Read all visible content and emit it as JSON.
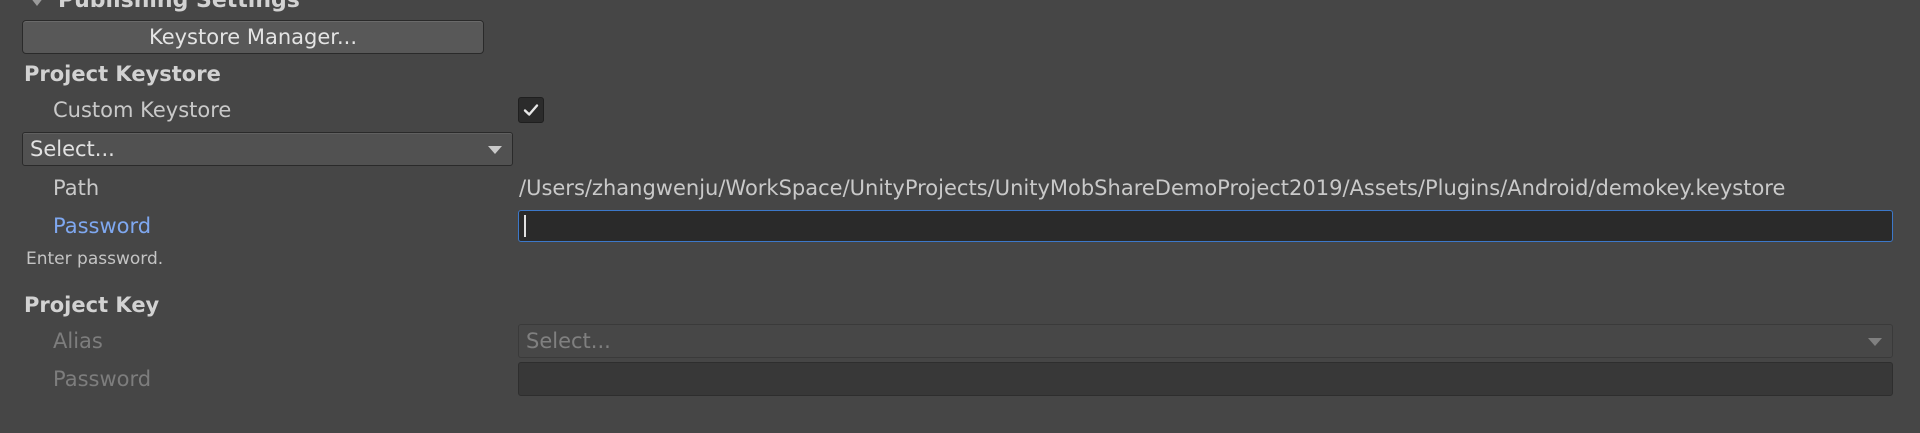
{
  "section": {
    "title": "Publishing Settings"
  },
  "keystore_manager_button": "Keystore Manager...",
  "project_keystore": {
    "heading": "Project Keystore",
    "custom_keystore_label": "Custom Keystore",
    "custom_keystore_checked": true,
    "keystore_dropdown_value": "Select...",
    "path_label": "Path",
    "path_value": "/Users/zhangwenju/WorkSpace/UnityProjects/UnityMobShareDemoProject2019/Assets/Plugins/Android/demokey.keystore",
    "password_label": "Password",
    "password_value": "",
    "password_hint": "Enter password."
  },
  "project_key": {
    "heading": "Project Key",
    "alias_label": "Alias",
    "alias_value": "Select...",
    "password_label": "Password",
    "password_value": ""
  },
  "colors": {
    "background": "#464646",
    "focus_label": "#7fa8f0",
    "focus_border": "#3c78c9",
    "field_background": "#2a2a2a"
  }
}
